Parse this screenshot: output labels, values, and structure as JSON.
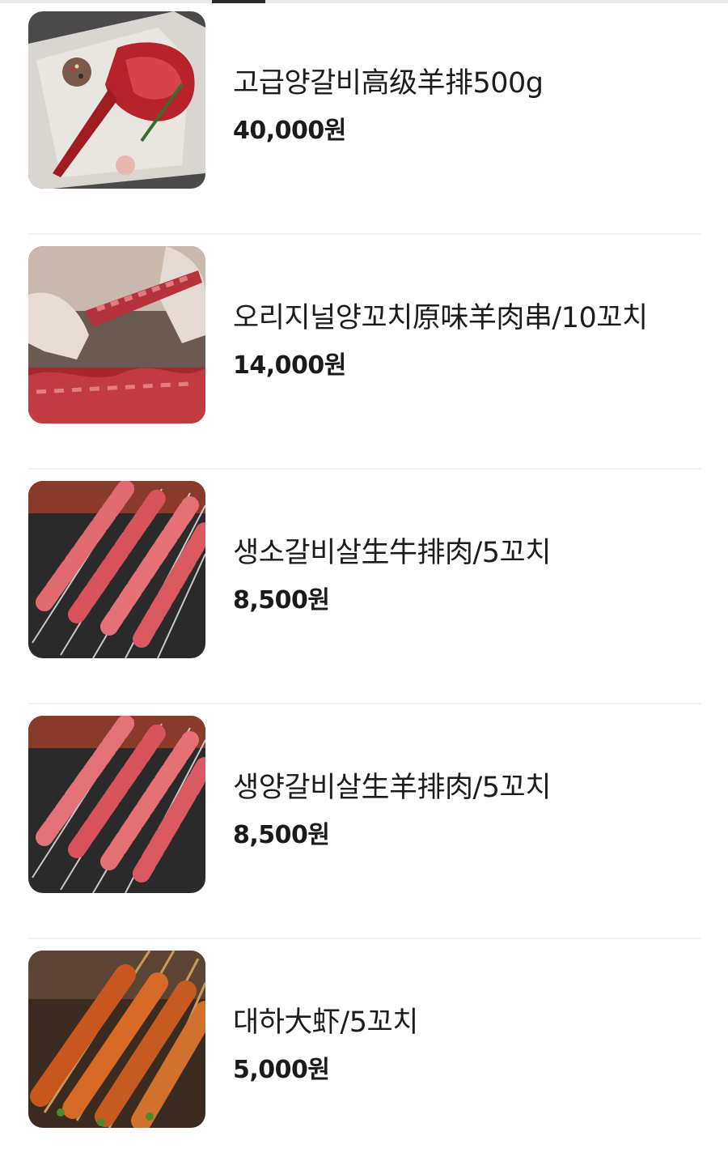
{
  "menu": {
    "items": [
      {
        "name": "고급양갈비高级羊排500g",
        "price": "40,000원",
        "image": "lamb-rack-photo"
      },
      {
        "name": "오리지널양꼬치原味羊肉串/10꼬치",
        "price": "14,000원",
        "image": "lamb-skewers-photo"
      },
      {
        "name": "생소갈비살生牛排肉/5꼬치",
        "price": "8,500원",
        "image": "beef-rib-skewers-photo"
      },
      {
        "name": "생양갈비살生羊排肉/5꼬치",
        "price": "8,500원",
        "image": "lamb-rib-skewers-photo"
      },
      {
        "name": "대하大虾/5꼬치",
        "price": "5,000원",
        "image": "prawn-skewers-photo"
      }
    ]
  }
}
